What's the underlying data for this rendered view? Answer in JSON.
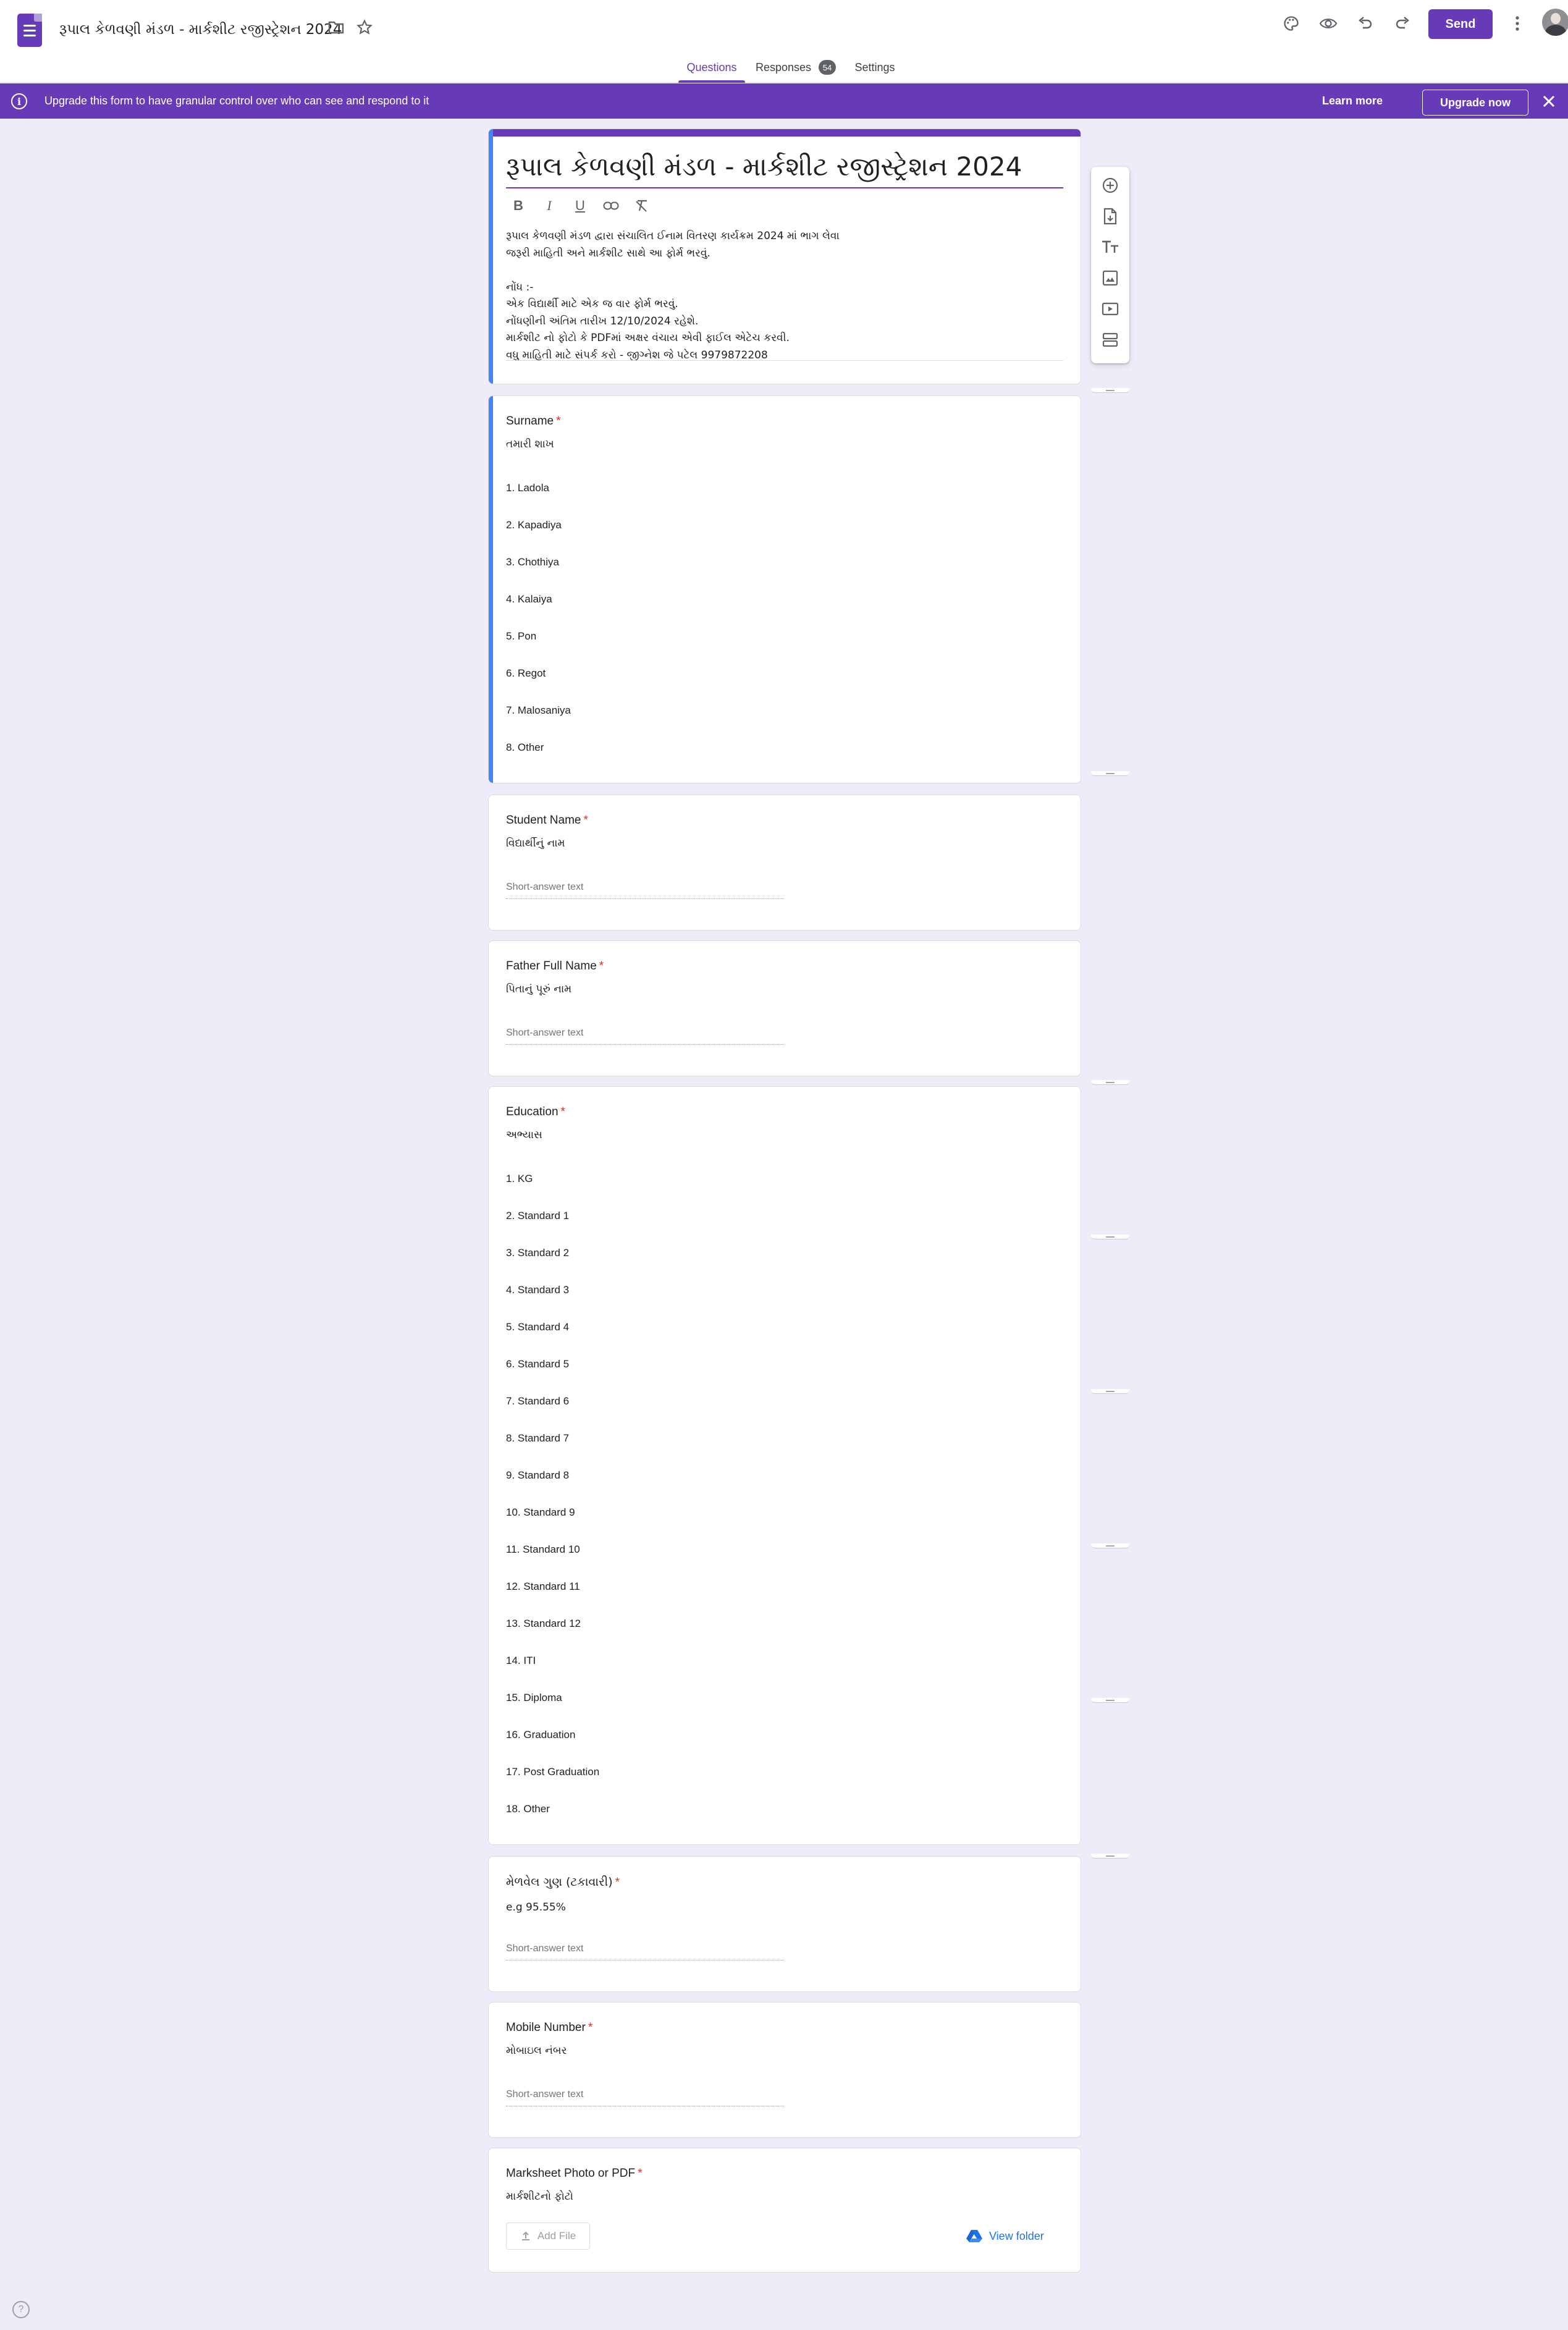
{
  "app": {
    "document_title": "રૂપાલ કેળવણી મંડળ - માર્કશીટ રજીસ્ટ્રેશન 2024",
    "send_label": "Send"
  },
  "tabs": [
    {
      "label": "Questions",
      "active": true
    },
    {
      "label": "Responses",
      "badge": "54"
    },
    {
      "label": "Settings"
    }
  ],
  "banner": {
    "text": "Upgrade this form to have granular control over who can see and respond to it",
    "learn_more": "Learn more",
    "upgrade": "Upgrade now"
  },
  "form": {
    "title": "રૂપાલ કેળવણી મંડળ - માર્કશીટ રજીસ્ટ્રેશન 2024",
    "description_lines": [
      "રૂપાલ કેળવણી મંડળ દ્વારા સંચાલિત ઈનામ વિતરણ કાર્યક્રમ 2024 માં ભાગ લેવા",
      "જરૂરી માહિતી અને માર્કશીટ સાથે આ ફોર્મ ભરવું.",
      "",
      "નોંધ :-",
      "એક વિદ્યાર્થી માટે એક જ વાર ફોર્મ ભરવું.",
      "નોંધણીની અંતિમ તારીખ 12/10/2024 રહેશે.",
      "માર્કશીટ નો ફોટો કે PDFમાં અક્ષર વંચાય એવી ફાઈલ એટેચ કરવી.",
      "વધુ માહિતી માટે સંપર્ક કરો - જીગ્નેશ જે પટેલ 9979872208"
    ]
  },
  "questions": [
    {
      "title": "Surname",
      "description": "તમારી શાખ",
      "options": [
        "1.  Ladola",
        "2.  Kapadiya",
        "3.  Chothiya",
        "4.  Kalaiya",
        "5.  Pon",
        "6.  Regot",
        "7.  Malosaniya",
        "8.  Other"
      ]
    },
    {
      "title": "Student Name",
      "description": "વિદ્યાર્થીનું નામ",
      "placeholder": "Short-answer text"
    },
    {
      "title": "Father Full Name",
      "description": "પિતાનું પૂરું નામ",
      "placeholder": "Short-answer text"
    },
    {
      "title": "Education",
      "description": "અભ્યાસ",
      "options": [
        "1.  KG",
        "2.  Standard 1",
        "3.  Standard 2",
        "4.  Standard 3",
        "5.  Standard 4",
        "6.  Standard 5",
        "7.  Standard 6",
        "8.  Standard 7",
        "9.  Standard 8",
        "10.  Standard 9",
        "11.  Standard 10",
        "12.  Standard 11",
        "13.  Standard 12",
        "14.  ITI",
        "15.  Diploma",
        "16.  Graduation",
        "17.  Post Graduation",
        "18.  Other"
      ]
    },
    {
      "title": "મેળવેલ ગુણ (ટકાવારી)",
      "description": "e.g 95.55%",
      "placeholder": "Short-answer text"
    },
    {
      "title": "Mobile Number",
      "description": "મોબાઇલ નંબર",
      "placeholder": "Short-answer text"
    },
    {
      "title": "Marksheet Photo or PDF",
      "description": "માર્કશીટનો ફોટો",
      "add_file": "Add File",
      "view_folder": "View folder"
    }
  ],
  "required_mark": "*",
  "colors": {
    "brand": "#673ab7",
    "background": "#f0ebf8",
    "selected_bar": "#4285f4",
    "required": "#d93025",
    "link": "#1a73e8"
  }
}
